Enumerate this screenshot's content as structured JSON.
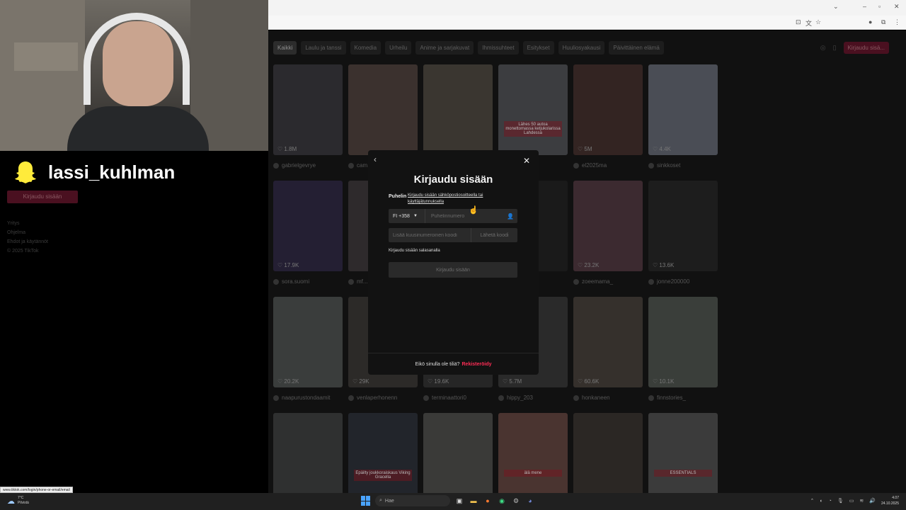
{
  "overlay": {
    "snap_username": "lassi_kuhlman"
  },
  "sidebar": {
    "login_label": "Kirjaudu sisään",
    "links": [
      "Yritys",
      "Ohjelma",
      "Ehdot ja käytännöt",
      "© 2025 TikTok"
    ]
  },
  "categories": [
    {
      "label": "Kaikki",
      "active": true
    },
    {
      "label": "Laulu ja tanssi"
    },
    {
      "label": "Komedia"
    },
    {
      "label": "Urheilu"
    },
    {
      "label": "Anime ja sarjakuvat"
    },
    {
      "label": "Ihmissuhteet"
    },
    {
      "label": "Esitykset"
    },
    {
      "label": "Huuliosyakausi"
    },
    {
      "label": "Päivittäinen elämä"
    }
  ],
  "header": {
    "login_button": "Kirjaudu sisä..."
  },
  "videos": [
    {
      "likes": "1.8M",
      "user": "gabrielgevrye",
      "color": "#2b2a2e"
    },
    {
      "likes": "",
      "user": "cam...",
      "color": "#3b312e"
    },
    {
      "likes": "",
      "user": "",
      "color": "#3a3630"
    },
    {
      "likes": "",
      "user": "",
      "color": "#3c3d40",
      "caption": "Lähes 50 autoa monettomassa ketjukolarissa Lahdessa"
    },
    {
      "likes": "5M",
      "user": "el2025ma",
      "color": "#332422"
    },
    {
      "likes": "4.4K",
      "user": "sinkkoset",
      "color": "#4a4d55"
    },
    {
      "likes": "17.9K",
      "user": "sora.suomi",
      "color": "#241f33"
    },
    {
      "likes": "",
      "user": "mf...",
      "color": "#2e2a2c"
    },
    {
      "likes": "",
      "user": "",
      "color": "#1a1a1a"
    },
    {
      "likes": "",
      "user": "",
      "color": "#1a1a1a"
    },
    {
      "likes": "23.2K",
      "user": "zoeemama_",
      "color": "#3c2a30"
    },
    {
      "likes": "13.6K",
      "user": "jonne200000",
      "color": "#1d1d1d"
    },
    {
      "likes": "20.2K",
      "user": "naapurustondaamit",
      "color": "#3a3d3c"
    },
    {
      "likes": "29K",
      "user": "venlaperhonenn",
      "color": "#2c2a28"
    },
    {
      "likes": "19.6K",
      "user": "terminaattori0",
      "color": "#262626"
    },
    {
      "likes": "5.7M",
      "user": "hippy_203",
      "color": "#2a2a2a"
    },
    {
      "likes": "60.6K",
      "user": "honkaneen",
      "color": "#35302c"
    },
    {
      "likes": "10.1K",
      "user": "finnstories_",
      "color": "#3a3e3a"
    },
    {
      "likes": "",
      "user": "",
      "color": "#2f3030"
    },
    {
      "likes": "",
      "user": "",
      "color": "#22252b",
      "caption": "Epäilty joukkoraiskaus Viking Gracella"
    },
    {
      "likes": "",
      "user": "",
      "color": "#3a3a38"
    },
    {
      "likes": "",
      "user": "",
      "color": "#4a3430",
      "caption": "älä mene"
    },
    {
      "likes": "",
      "user": "",
      "color": "#2b2724"
    },
    {
      "likes": "",
      "user": "",
      "color": "#3b3b3b",
      "caption": "ESSENTIALS"
    }
  ],
  "modal": {
    "back": "‹",
    "close": "✕",
    "title": "Kirjaudu sisään",
    "phone_label": "Puhelin",
    "email_link": "Kirjaudu sisään sähköpostiosoitteella tai käyttäjätunnuksella",
    "country_code": "FI +358",
    "phone_placeholder": "Puhelinnumero",
    "code_placeholder": "Lisää kuusinumeroinen koodi",
    "send_code": "Lähetä koodi",
    "password_link": "Kirjaudu sisään salasanalla",
    "login_button": "Kirjaudu sisään",
    "footer_text": "Eikö sinulla ole tiliä?",
    "footer_link": "Rekisteröidy"
  },
  "status_url": "www.tiktok.com/login/phone-or-email/email",
  "taskbar": {
    "weather_temp": "7°C",
    "weather_desc": "Pilvistä",
    "search_placeholder": "Hae",
    "time": "4.07",
    "date": "24.10.2025"
  },
  "colors": {
    "accent": "#fe2c55",
    "snap_yellow": "#ffeb3b"
  }
}
